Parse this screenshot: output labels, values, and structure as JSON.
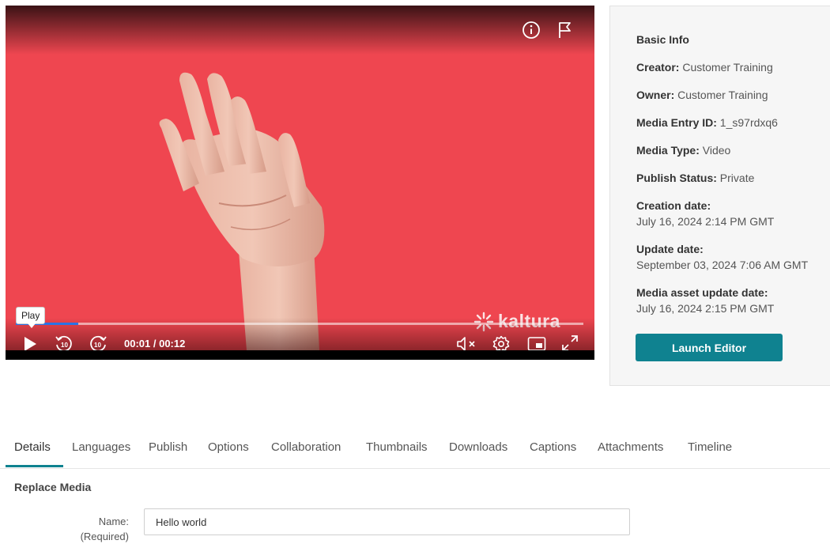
{
  "player": {
    "tooltip": "Play",
    "time": "00:01 / 00:12",
    "progress_fraction": 0.11,
    "logo_text": "kaltura",
    "icons": [
      "info-icon",
      "flag-icon",
      "play-icon",
      "rewind-10-icon",
      "forward-10-icon",
      "mute-icon",
      "settings-icon",
      "picture-in-picture-icon",
      "fullscreen-icon"
    ],
    "background_color": "#ef4650"
  },
  "info": {
    "title": "Basic Info",
    "creator_label": "Creator:",
    "creator_value": " Customer Training",
    "owner_label": "Owner:",
    "owner_value": " Customer Training",
    "entry_id_label": "Media Entry ID:",
    "entry_id_value": " 1_s97rdxq6",
    "media_type_label": "Media Type:",
    "media_type_value": " Video",
    "publish_status_label": "Publish Status:",
    "publish_status_value": " Private",
    "creation_date_label": "Creation date:",
    "creation_date_value": "July 16, 2024 2:14 PM GMT",
    "update_date_label": "Update date:",
    "update_date_value": "September 03, 2024 7:06 AM GMT",
    "asset_update_label": "Media asset update date:",
    "asset_update_value": "July 16, 2024 2:15 PM GMT",
    "launch_button": "Launch Editor",
    "accent_color": "#0f8290"
  },
  "tabs": [
    {
      "label": "Details",
      "active": true
    },
    {
      "label": "Languages"
    },
    {
      "label": "Publish"
    },
    {
      "label": "Options"
    },
    {
      "label": "Collaboration"
    },
    {
      "label": "Thumbnails"
    },
    {
      "label": "Downloads"
    },
    {
      "label": "Captions"
    },
    {
      "label": "Attachments"
    },
    {
      "label": "Timeline"
    }
  ],
  "form": {
    "section_title": "Replace Media",
    "name_label": "Name:",
    "name_required": "(Required)",
    "name_value": "Hello world"
  }
}
